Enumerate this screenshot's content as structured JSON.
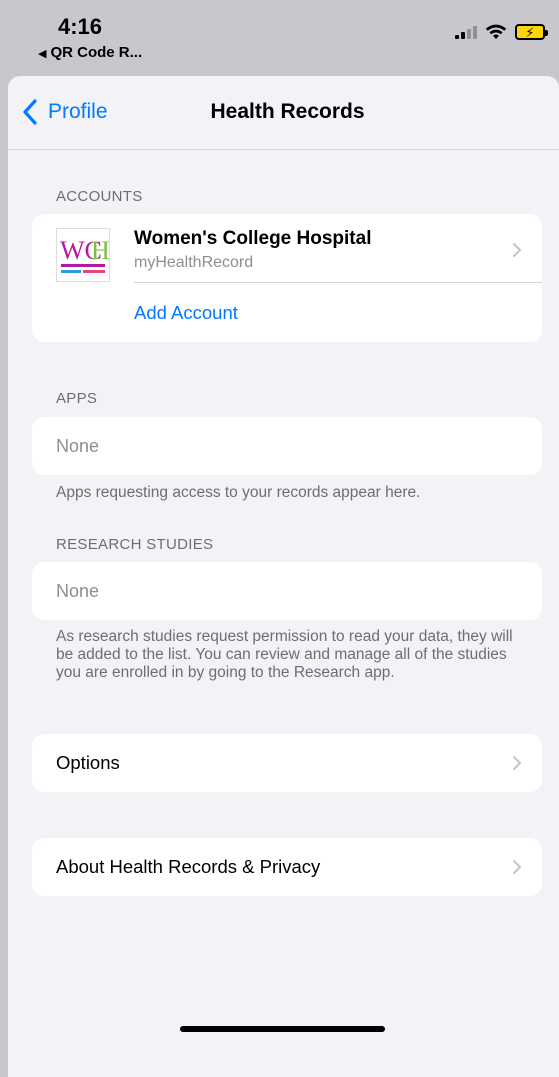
{
  "status_bar": {
    "time": "4:16",
    "back_app_label": "QR Code R..."
  },
  "nav": {
    "back_label": "Profile",
    "title": "Health Records"
  },
  "accounts": {
    "header": "ACCOUNTS",
    "items": [
      {
        "name": "Women's College Hospital",
        "subtitle": "myHealthRecord",
        "logo_text": "WCH"
      }
    ],
    "add_label": "Add Account"
  },
  "apps": {
    "header": "APPS",
    "empty_label": "None",
    "footer": "Apps requesting access to your records appear here."
  },
  "research": {
    "header": "RESEARCH STUDIES",
    "empty_label": "None",
    "footer": "As research studies request permission to read your data, they will be added to the list. You can review and manage all of the studies you are enrolled in by going to the Research app."
  },
  "options": {
    "label": "Options"
  },
  "about": {
    "label": "About Health Records & Privacy"
  },
  "colors": {
    "accent": "#007aff",
    "secondary_text": "#6d6d72",
    "background": "#f2f2f7",
    "battery_charging": "#ffd60a"
  }
}
